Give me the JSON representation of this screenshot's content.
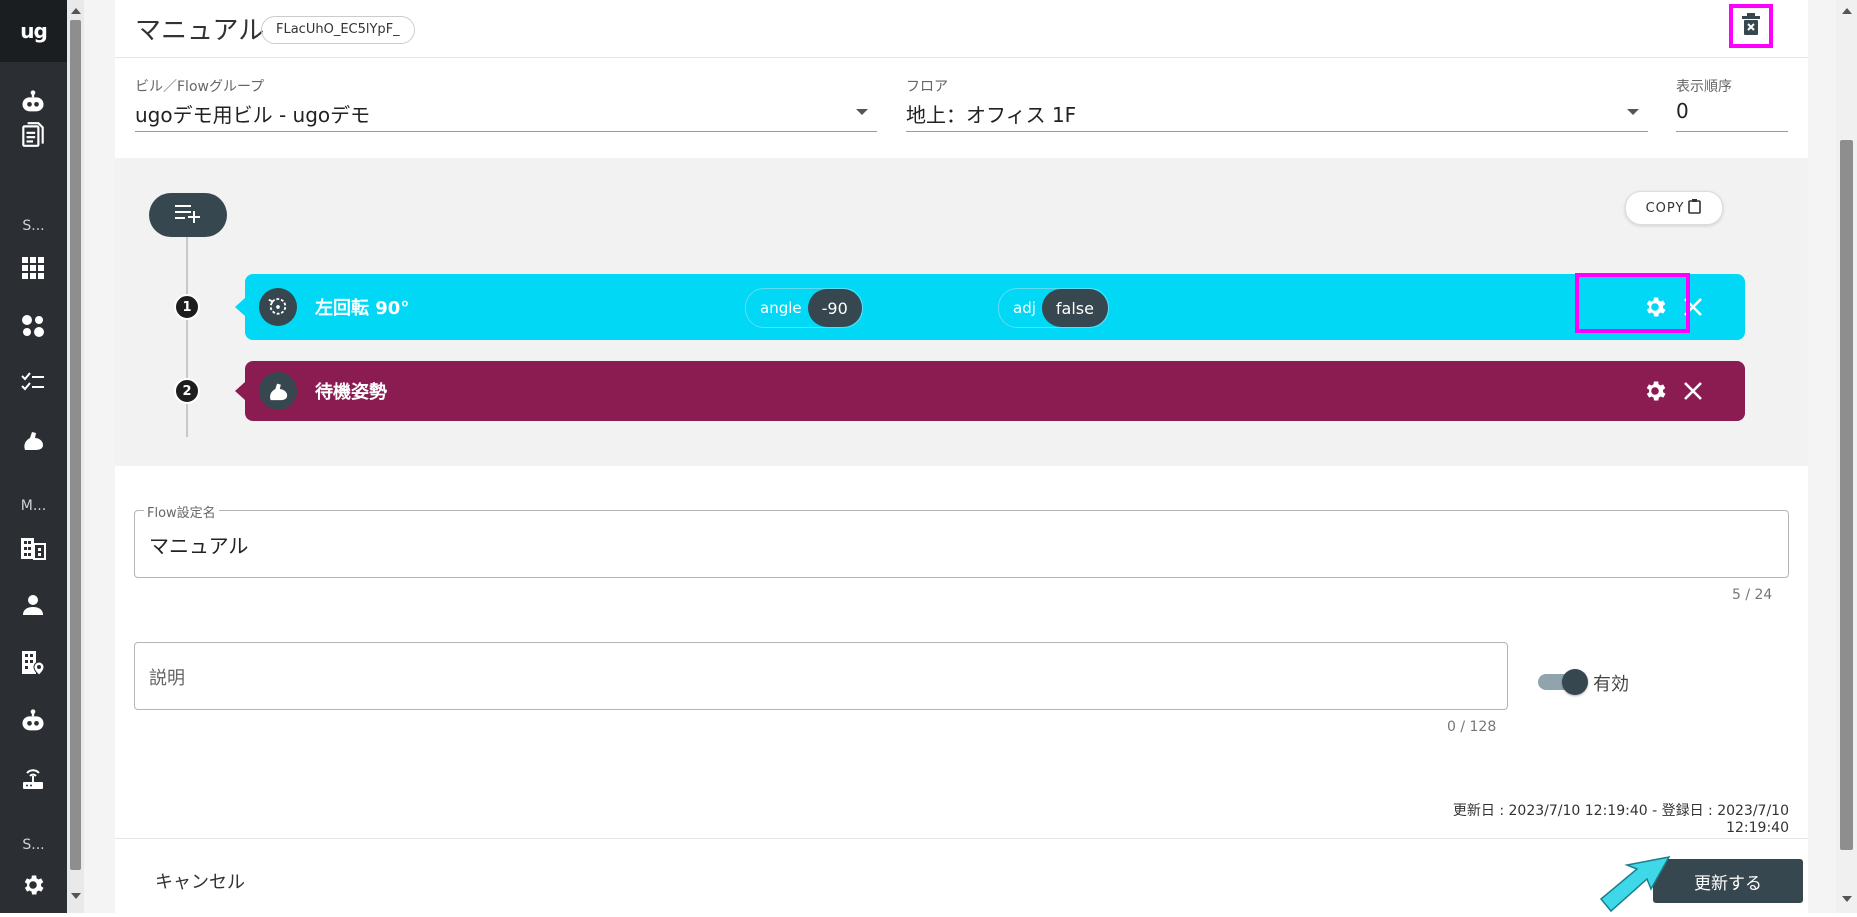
{
  "nav": {
    "logo": "ug",
    "sections": [
      "S...",
      "M...",
      "S..."
    ],
    "icons": [
      "robot-icon",
      "document-icon",
      "grid-icon",
      "tools-icon",
      "checklist-icon",
      "arm-icon",
      "building-icon",
      "user-icon",
      "building-pin-icon",
      "robot-icon",
      "router-icon",
      "gear-icon"
    ]
  },
  "header": {
    "title": "マニュアル",
    "id_chip": "FLacUhO_EC5lYpF_",
    "trash_icon": "trash-icon"
  },
  "fields": {
    "building_group_label": "ビル／Flowグループ",
    "building_group_value": "ugoデモ用ビル - ugoデモ",
    "floor_label": "フロア",
    "floor_value": "地上：オフィス 1F",
    "order_label": "表示順序",
    "order_value": "0"
  },
  "flow": {
    "copy_label": "COPY",
    "steps": [
      {
        "num": "1",
        "name": "左回転 90°",
        "color": "#00d8f5",
        "params": [
          {
            "key": "angle",
            "value": "-90"
          },
          {
            "key": "adj",
            "value": "false"
          }
        ]
      },
      {
        "num": "2",
        "name": "待機姿勢",
        "color": "#8b1c52",
        "params": []
      }
    ]
  },
  "form": {
    "name_legend": "Flow設定名",
    "name_value": "マニュアル",
    "name_counter": "5 / 24",
    "desc_placeholder": "説明",
    "desc_counter": "0 / 128",
    "toggle_label": "有効",
    "toggle_on": true,
    "timestamps": "更新日 : 2023/7/10 12:19:40 - 登録日 : 2023/7/10 12:19:40"
  },
  "footer": {
    "cancel_label": "キャンセル",
    "update_label": "更新する"
  },
  "colors": {
    "nav_bg": "#2b2f33",
    "highlight": "#ff00ff",
    "step1": "#00d8f5",
    "step2": "#8b1c52",
    "dark": "#37474f",
    "arrow": "#3fd8e8"
  }
}
